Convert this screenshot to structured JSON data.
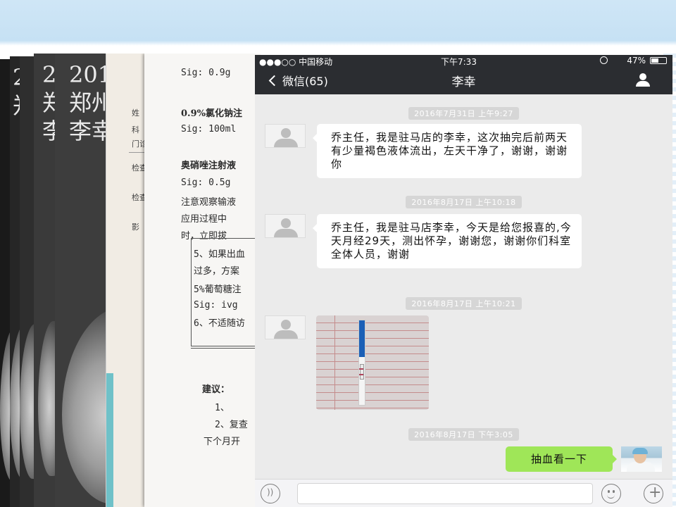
{
  "background_cards": {
    "x_ray_caption": {
      "line1": "201",
      "line2": "郑州",
      "line3": "李幸"
    },
    "report_form": {
      "labels": [
        "姓",
        "科",
        "门诊",
        "检查",
        "检查",
        "影"
      ]
    },
    "prescription": {
      "lines": [
        "Sig:  0.9g",
        "0.9%氯化钠注",
        "Sig: 100ml",
        "奥硝唑注射液",
        "Sig: 0.5g",
        "注意观察输液",
        "应用过程中",
        "时，立即拔",
        "5、如果出血",
        "过多，方案",
        "5%葡萄糖注",
        "Sig:   ivg",
        "6、不适随访",
        "建议：",
        "1、",
        "2、复查",
        "下个月开"
      ]
    }
  },
  "phone": {
    "status_bar": {
      "carrier": "●●●○○ 中国移动",
      "time": "下午7:33",
      "battery": "47%"
    },
    "nav": {
      "back_label": "微信(65)",
      "title": "李幸"
    },
    "messages": [
      {
        "timestamp": "2016年7月31日 上午9:27",
        "text": "乔主任，我是驻马店的李幸，这次抽完后前两天有少量褐色液体流出，左天干净了，谢谢，谢谢你"
      },
      {
        "timestamp": "2016年8月17日 上午10:18",
        "text": "乔主任，我是驻马店李幸，今天是给您报喜的,今天月经29天，测出怀孕，谢谢您，谢谢你们科室全体人员，谢谢"
      },
      {
        "timestamp": "2016年8月17日 上午10:21",
        "image": "pregnancy-test-photo"
      },
      {
        "timestamp": "2016年8月17日 下午3:05",
        "reply": "抽血看一下"
      }
    ]
  },
  "colors": {
    "slide_top": "#c6e1f4",
    "nav_dark": "#2b2d31",
    "chat_bg": "#ebebeb",
    "bubble_out": "#9fe658"
  }
}
